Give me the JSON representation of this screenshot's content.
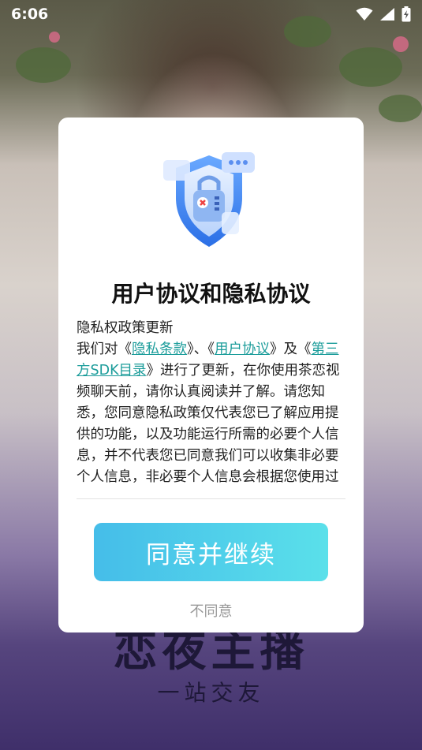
{
  "status_bar": {
    "time": "6:06"
  },
  "background": {
    "title": "恋夜主播",
    "subtitle": "一站交友"
  },
  "dialog": {
    "title": "用户协议和隐私协议",
    "body": {
      "heading": "隐私权政策更新",
      "p1_start": "我们对《",
      "link_privacy": "隐私条款",
      "p1_mid1": "》、《",
      "link_user": "用户协议",
      "p1_mid2": "》及《",
      "link_sdk": "第三方SDK目录",
      "p1_rest": "》进行了更新，在你使用茶恋视频聊天前，请你认真阅读并了解。请您知悉，您同意隐私政策仅代表您已了解应用提供的功能，以及功能运行所需的必要个人信息，并不代表您已同意我们可以收集非必要个人信息，非必要个人信息会根据您使用过"
    },
    "agree_label": "同意并继续",
    "disagree_label": "不同意"
  },
  "colors": {
    "accent_link": "#1b9c9a",
    "button_gradient_start": "#45bde9",
    "button_gradient_end": "#5ae0ea",
    "shield_blue": "#3b82f0"
  },
  "icons": {
    "status": [
      "wifi-icon",
      "cellular-signal-icon",
      "battery-charging-icon"
    ],
    "dialog": "privacy-shield-icon"
  }
}
